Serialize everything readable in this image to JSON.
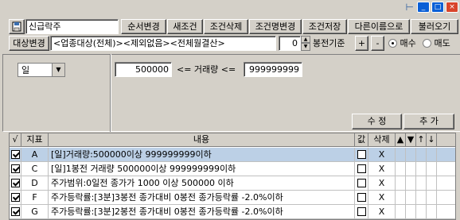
{
  "window": {
    "controls": [
      "_",
      "□",
      "×"
    ],
    "pin_glyph": "⊢"
  },
  "toolbar": {
    "name_value": "신급락주",
    "buttons": [
      "순서변경",
      "새조건",
      "조건삭제",
      "조건명변경",
      "조건저장",
      "다른이름으로",
      "불러오기"
    ]
  },
  "target": {
    "label": "대상변경",
    "value": "<업종대상(전체)><제외없음><전체월결산>",
    "offset_value": "0",
    "offset_label": "봉전기준",
    "plus": "+",
    "minus": "-",
    "buy_label": "매수",
    "sell_label": "매도",
    "buy_selected": true
  },
  "condition": {
    "period": "일",
    "min_value": "500000",
    "mid_label": "<= 거래량 <=",
    "max_value": "999999999",
    "edit_button": "수  정",
    "add_button": "추  가"
  },
  "grid": {
    "headers": [
      "√",
      "지표",
      "내용",
      "값",
      "삭제",
      "▲",
      "▼",
      "↑",
      "↓"
    ],
    "rows": [
      {
        "checked": true,
        "code": "A",
        "content": "[일]거래량:500000이상 999999999이하",
        "value_checked": false,
        "delete": "X",
        "selected": true
      },
      {
        "checked": true,
        "code": "C",
        "content": "[일]1봉전 거래량 500000이상 999999999이하",
        "value_checked": false,
        "delete": "X",
        "selected": false
      },
      {
        "checked": true,
        "code": "D",
        "content": "주가범위:0일전 종가가 1000 이상 500000 이하",
        "value_checked": false,
        "delete": "X",
        "selected": false
      },
      {
        "checked": true,
        "code": "F",
        "content": "주가등락률:[3분]3봉전 종가대비 0봉전 종가등락률 -2.0%이하",
        "value_checked": false,
        "delete": "X",
        "selected": false
      },
      {
        "checked": true,
        "code": "G",
        "content": "주가등락률:[3분]2봉전 종가대비 0봉전 종가등락률 -2.0%이하",
        "value_checked": false,
        "delete": "X",
        "selected": false
      }
    ]
  }
}
